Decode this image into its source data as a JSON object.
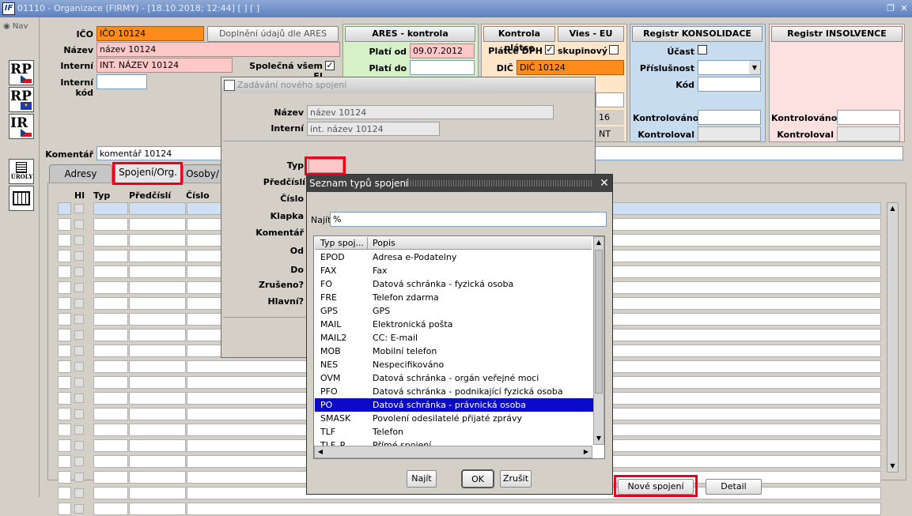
{
  "window": {
    "title": "01110 - Organizace (FIRMY) - [18.10.2018; 12:44]  [ ]  [ ]"
  },
  "nav": {
    "label": "Nav"
  },
  "side_icons": [
    "RP",
    "RP",
    "IR",
    "ÚROLY",
    ""
  ],
  "header": {
    "ico_label": "IČO",
    "ico_value": "IČO 10124",
    "nazev_label": "Název",
    "nazev_value": "název 10124",
    "interni_label": "Interní",
    "interni_value": "INT. NÁZEV 10124",
    "spolecna_label": "Společná všem EJ",
    "spolecna_checked": "✓",
    "interni_kod_label": "Interní kód",
    "interni_kod_value": "",
    "ares_button": "Doplnění údajů dle ARES",
    "komentar_label": "Komentář",
    "komentar_value": "komentář 10124"
  },
  "ares": {
    "title": "ARES - kontrola",
    "plati_od_label": "Platí od",
    "plati_od_value": "09.07.2012",
    "plati_do_label": "Platí do",
    "plati_do_value": ""
  },
  "kontrola": {
    "title": "Kontrola plátce",
    "vies_title": "Vies - EU",
    "platce_label": "Plátce DPH",
    "platce_checked": "✓",
    "skupinovy_label": "skupinový",
    "dic_label": "DIČ",
    "dic_value": "DIČ 10124",
    "partial_value": "16",
    "partial_value2": "NT"
  },
  "konsolidace": {
    "title": "Registr KONSOLIDACE",
    "ucast_label": "Účast",
    "prislusnost_label": "Příslušnost",
    "kod_label": "Kód",
    "kontrolovano_label": "Kontrolováno",
    "kontroloval_label": "Kontroloval"
  },
  "insolvence": {
    "title": "Registr INSOLVENCE",
    "kontrolovano_label": "Kontrolováno",
    "kontroloval_label": "Kontroloval"
  },
  "tabs": [
    "Adresy",
    "Spojení/Org.",
    "Osoby/"
  ],
  "grid": {
    "headers": [
      "Hl",
      "Typ",
      "Předčíslí",
      "Číslo"
    ]
  },
  "buttons": {
    "nove_spojeni": "Nové spojení",
    "detail": "Detail"
  },
  "dialog1": {
    "title": "Zadávání nového spojení",
    "nazev_label": "Název",
    "nazev_value": "název 10124",
    "interni_label": "Interní",
    "interni_value": "int. název 10124",
    "typ_label": "Typ",
    "predcisli_label": "Předčíslí",
    "cislo_label": "Číslo",
    "klapka_label": "Klapka",
    "komentar_label": "Komentář",
    "od_label": "Od",
    "do_label": "Do",
    "zruseno_label": "Zrušeno?",
    "hlavni_label": "Hlavní?"
  },
  "dialog2": {
    "title": "Seznam typů spojení",
    "najit_label": "Najít",
    "najit_value": "%",
    "col_typ": "Typ spoj...",
    "col_popis": "Popis",
    "rows": [
      {
        "typ": "EPOD",
        "popis": "Adresa e-Podatelny"
      },
      {
        "typ": "FAX",
        "popis": "Fax"
      },
      {
        "typ": "FO",
        "popis": "Datová schránka - fyzická osoba"
      },
      {
        "typ": "FRE",
        "popis": "Telefon zdarma"
      },
      {
        "typ": "GPS",
        "popis": "GPS"
      },
      {
        "typ": "MAIL",
        "popis": "Elektronická pošta"
      },
      {
        "typ": "MAIL2",
        "popis": "CC: E-mail"
      },
      {
        "typ": "MOB",
        "popis": "Mobilní telefon"
      },
      {
        "typ": "NES",
        "popis": "Nespecifikováno"
      },
      {
        "typ": "OVM",
        "popis": "Datová schránka - orgán veřejné moci"
      },
      {
        "typ": "PFO",
        "popis": "Datová schránka - podnikající fyzická osoba"
      },
      {
        "typ": "PO",
        "popis": "Datová schránka - právnická osoba"
      },
      {
        "typ": "SMASK",
        "popis": "Povolení odesilatelé přijaté zprávy"
      },
      {
        "typ": "TLF",
        "popis": "Telefon"
      },
      {
        "typ": "TLF_P",
        "popis": "Přímé spojení"
      }
    ],
    "selected_index": 11,
    "btn_najit": "Najít",
    "btn_ok": "OK",
    "btn_zrusit": "Zrušit"
  },
  "colors": {
    "orange": "#ff8c1a",
    "pink": "#ffc8c8",
    "green_panel": "#d6f0c8",
    "orange_panel": "#ffe6c8",
    "blue_panel": "#c8dcf0",
    "pink_panel": "#fde0e0",
    "selected": "#0a0ac8",
    "highlight": "#e8001c"
  }
}
